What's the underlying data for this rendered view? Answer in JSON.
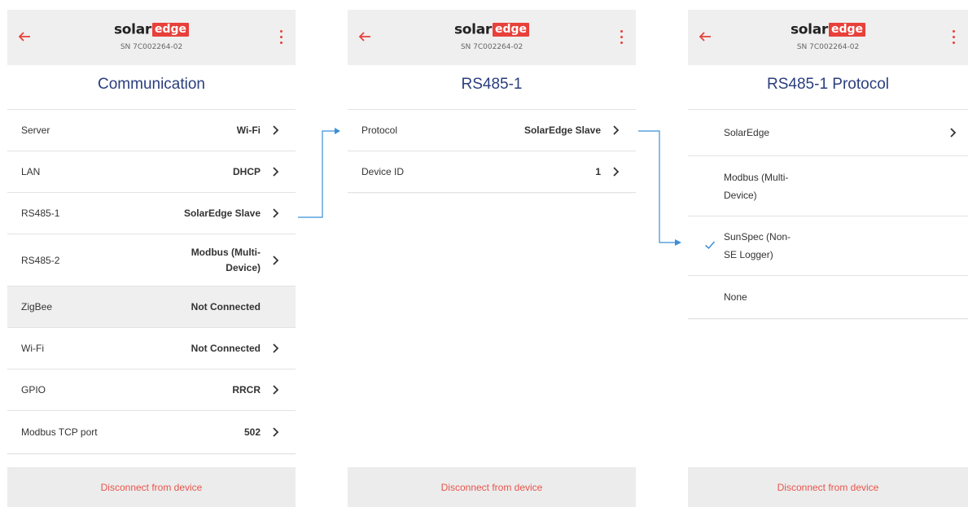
{
  "brand": {
    "solar": "solar",
    "edge": "edge"
  },
  "colors": {
    "accent": "#e8403a",
    "title": "#2a3e7e",
    "connector": "#3b8fd9",
    "footer_text": "#e8544c"
  },
  "screens": [
    {
      "serial": "SN 7C002264-02",
      "title": "Communication",
      "rows": [
        {
          "label": "Server",
          "value": "Wi-Fi"
        },
        {
          "label": "LAN",
          "value": "DHCP"
        },
        {
          "label": "RS485-1",
          "value": "SolarEdge Slave"
        },
        {
          "label": "RS485-2",
          "value_line1": "Modbus (Multi-",
          "value_line2": "Device)"
        },
        {
          "label": "ZigBee",
          "value": "Not Connected"
        },
        {
          "label": "Wi-Fi",
          "value": "Not Connected"
        },
        {
          "label": "GPIO",
          "value": "RRCR"
        },
        {
          "label": "Modbus TCP port",
          "value": "502"
        }
      ],
      "footer": "Disconnect from device"
    },
    {
      "serial": "SN 7C002264-02",
      "title": "RS485-1",
      "rows": [
        {
          "label": "Protocol",
          "value": "SolarEdge Slave"
        },
        {
          "label": "Device ID",
          "value": "1"
        }
      ],
      "footer": "Disconnect from device"
    },
    {
      "serial": "SN 7C002264-02",
      "title": "RS485-1 Protocol",
      "options": [
        {
          "line1": "SolarEdge",
          "line2": ""
        },
        {
          "line1": "Modbus (Multi-",
          "line2": "Device)"
        },
        {
          "line1": "SunSpec (Non-",
          "line2": "SE Logger)",
          "selected": true
        },
        {
          "line1": "None",
          "line2": ""
        }
      ],
      "footer": "Disconnect from device"
    }
  ]
}
